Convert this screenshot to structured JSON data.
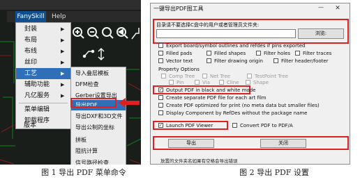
{
  "left_figure": {
    "menubar": {
      "fanyskill": "FanySkill",
      "help": "Help"
    },
    "main_menu": [
      {
        "label": "封装",
        "has_submenu": true
      },
      {
        "label": "布局",
        "has_submenu": true
      },
      {
        "label": "布线",
        "has_submenu": true
      },
      {
        "label": "丝印",
        "has_submenu": true
      },
      {
        "label": "工艺",
        "has_submenu": true,
        "selected": true
      },
      {
        "label": "辅助功能",
        "has_submenu": true
      },
      {
        "label": "凡亿服务",
        "has_submenu": true
      },
      {
        "label": "菜单编辑",
        "has_submenu": false
      },
      {
        "label": "卸载程序",
        "has_submenu": false
      },
      {
        "label": "版本",
        "has_submenu": false
      }
    ],
    "submenu": [
      "导入叠层模板",
      "DFM检查",
      "Gerber设置导出",
      "导出PDF",
      "导出DXF和3D文件",
      "导出公制的坐标",
      "拼板",
      "阻抗计算",
      "信号路径检查"
    ],
    "submenu_selected_index": 3,
    "submenu_arrow_glyph": "▶",
    "icons": [
      "zoom-in-icon",
      "zoom-out-icon",
      "zoom-fit-icon",
      "zoom-prev-icon",
      "route-icon",
      "route-icon",
      "move-icon"
    ]
  },
  "right_figure": {
    "title": "一键导出PDF图工具",
    "minimize_glyph": "—",
    "close_glyph": "✕",
    "output_label": "目录请不要选择C盘中的用户或者管理员文件夹:",
    "output_value": "",
    "browse_label": "浏览:",
    "options": {
      "export_board": "Export board/symbol outlines and refdes if pins exported",
      "filled_pads": "Filled pads",
      "filled_shapes": "Filled shapes",
      "filter_holes": "Filter holes",
      "filter_traces": "Filter traces",
      "vector_text": "Vector text",
      "filter_drawing_origin": "Filter drawing origin",
      "filter_header_footer": "Filter header/footer"
    },
    "property_options_title": "Property Options",
    "property_options": {
      "comp_tree": "Comp Tree",
      "net_tree": "Net Tree",
      "testpoint_tree": "TestPoint Tree",
      "pin": "Pin",
      "via": "Via",
      "cline": "Cline",
      "shape": "Shape"
    },
    "output_black_white": "Output PDF in black and white mode",
    "create_separate": "Create separate PDF file for each art film",
    "create_optimized": "Create PDF optimized for print (no meta data but smaller files)",
    "display_component": "Display Component by RefDes without the package name",
    "launch_viewer": "Launch PDF Viewer",
    "convert_pdfa": "Convert PDF to PDF/A",
    "checked_glyph": "✓",
    "export_button": "导出",
    "close_button": "关闭",
    "footer": "放置的文件夹名如果有空格会导出错误"
  },
  "captions": {
    "fig1": "图 1 导出 PDF 菜单命令",
    "fig2": "图 2 导出 PDF 设置"
  },
  "colors": {
    "highlight": "#e02020",
    "menu_selected": "#2f6fb8",
    "menubar_active": "#0f4f8f"
  }
}
